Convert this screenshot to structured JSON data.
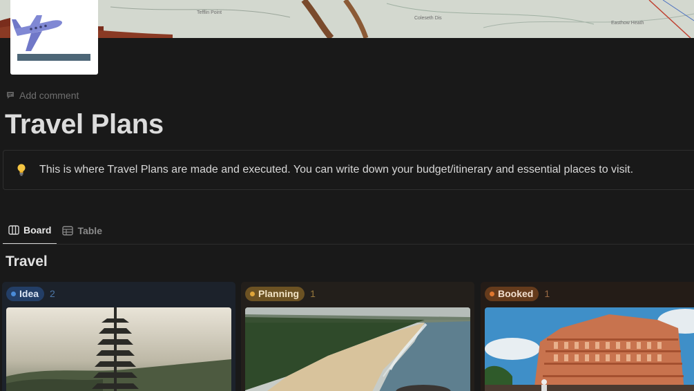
{
  "page": {
    "comment_label": "Add comment",
    "title": "Travel Plans",
    "callout_icon": "lightbulb-icon",
    "callout_text": "This is where Travel Plans are made and executed. You can write down your budget/itinerary and essential places to visit."
  },
  "views": [
    {
      "label": "Board",
      "icon": "board-view-icon",
      "active": true
    },
    {
      "label": "Table",
      "icon": "table-view-icon",
      "active": false
    }
  ],
  "database": {
    "title": "Travel",
    "columns": [
      {
        "label": "Idea",
        "count": "2",
        "color": "#4a8bd8"
      },
      {
        "label": "Planning",
        "count": "1",
        "color": "#e0a63a"
      },
      {
        "label": "Booked",
        "count": "1",
        "color": "#e0772f"
      }
    ]
  }
}
